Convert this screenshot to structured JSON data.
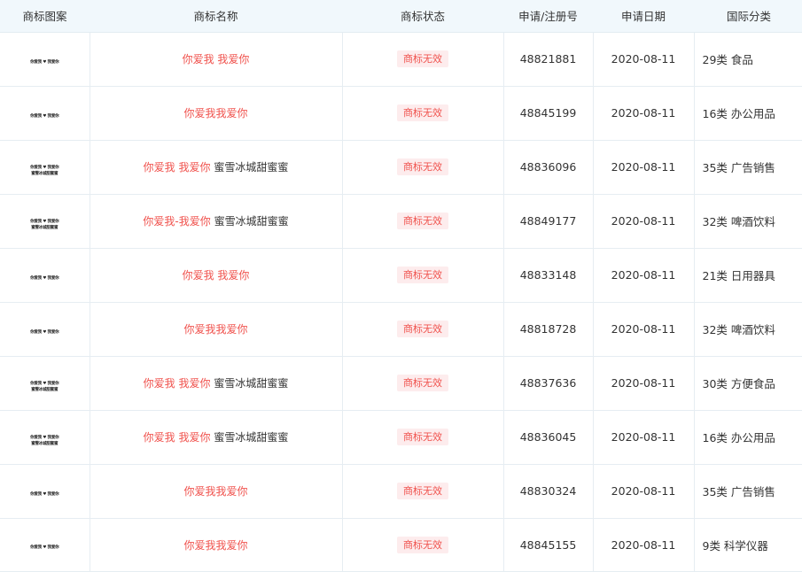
{
  "table": {
    "headers": {
      "logo": "商标图案",
      "name": "商标名称",
      "status": "商标状态",
      "reg_no": "申请/注册号",
      "date": "申请日期",
      "class": "国际分类"
    },
    "rows": [
      {
        "logo_lines": [
          "你爱我 ♥ 我爱你"
        ],
        "name_red": "你爱我 我爱你",
        "name_dark": "",
        "status": "商标无效",
        "reg_no": "48821881",
        "date": "2020-08-11",
        "class": "29类 食品"
      },
      {
        "logo_lines": [
          "你爱我 ♥ 我爱你"
        ],
        "name_red": "你爱我我爱你",
        "name_dark": "",
        "status": "商标无效",
        "reg_no": "48845199",
        "date": "2020-08-11",
        "class": "16类 办公用品"
      },
      {
        "logo_lines": [
          "你爱我 ♥ 我爱你",
          "蜜雪冰城甜蜜蜜"
        ],
        "name_red": "你爱我 我爱你",
        "name_dark": "蜜雪冰城甜蜜蜜",
        "status": "商标无效",
        "reg_no": "48836096",
        "date": "2020-08-11",
        "class": "35类 广告销售"
      },
      {
        "logo_lines": [
          "你爱我 ♥ 我爱你",
          "蜜雪冰城甜蜜蜜"
        ],
        "name_red": "你爱我-我爱你",
        "name_dark": "蜜雪冰城甜蜜蜜",
        "status": "商标无效",
        "reg_no": "48849177",
        "date": "2020-08-11",
        "class": "32类 啤酒饮料"
      },
      {
        "logo_lines": [
          "你爱我 ♥ 我爱你"
        ],
        "name_red": "你爱我 我爱你",
        "name_dark": "",
        "status": "商标无效",
        "reg_no": "48833148",
        "date": "2020-08-11",
        "class": "21类 日用器具"
      },
      {
        "logo_lines": [
          "你爱我 ♥ 我爱你"
        ],
        "name_red": "你爱我我爱你",
        "name_dark": "",
        "status": "商标无效",
        "reg_no": "48818728",
        "date": "2020-08-11",
        "class": "32类 啤酒饮料"
      },
      {
        "logo_lines": [
          "你爱我 ♥ 我爱你",
          "蜜雪冰城甜蜜蜜"
        ],
        "name_red": "你爱我 我爱你",
        "name_dark": "蜜雪冰城甜蜜蜜",
        "status": "商标无效",
        "reg_no": "48837636",
        "date": "2020-08-11",
        "class": "30类 方便食品"
      },
      {
        "logo_lines": [
          "你爱我 ♥ 我爱你",
          "蜜雪冰城甜蜜蜜"
        ],
        "name_red": "你爱我 我爱你",
        "name_dark": "蜜雪冰城甜蜜蜜",
        "status": "商标无效",
        "reg_no": "48836045",
        "date": "2020-08-11",
        "class": "16类 办公用品"
      },
      {
        "logo_lines": [
          "你爱我 ♥ 我爱你"
        ],
        "name_red": "你爱我我爱你",
        "name_dark": "",
        "status": "商标无效",
        "reg_no": "48830324",
        "date": "2020-08-11",
        "class": "35类 广告销售"
      },
      {
        "logo_lines": [
          "你爱我 ♥ 我爱你"
        ],
        "name_red": "你爱我我爱你",
        "name_dark": "",
        "status": "商标无效",
        "reg_no": "48845155",
        "date": "2020-08-11",
        "class": "9类 科学仪器"
      }
    ]
  },
  "colors": {
    "header_bg": "#f1f8fc",
    "accent_red": "#f0524d",
    "badge_bg": "#fdeced",
    "grid_line": "#e6edf2"
  }
}
